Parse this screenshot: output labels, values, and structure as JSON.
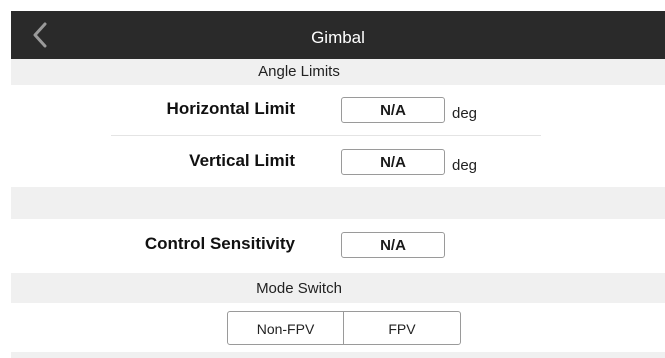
{
  "header": {
    "title": "Gimbal",
    "back_icon": "chevron-left-icon"
  },
  "angle_limits": {
    "section_label": "Angle Limits",
    "horizontal": {
      "label": "Horizontal Limit",
      "value": "N/A",
      "unit": "deg"
    },
    "vertical": {
      "label": "Vertical Limit",
      "value": "N/A",
      "unit": "deg"
    }
  },
  "control_sensitivity": {
    "label": "Control Sensitivity",
    "value": "N/A"
  },
  "mode_switch": {
    "section_label": "Mode Switch",
    "options": [
      "Non-FPV",
      "FPV"
    ]
  }
}
